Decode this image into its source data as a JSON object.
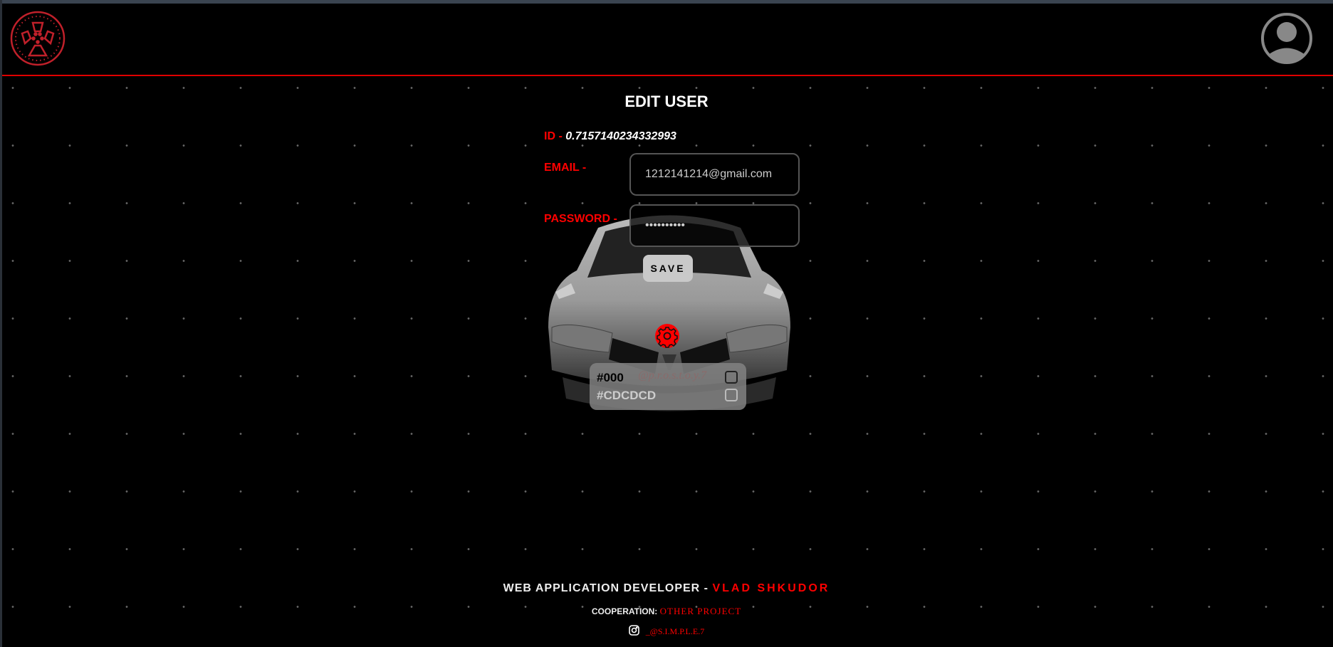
{
  "colors": {
    "accent": "#ff0000",
    "background": "#000000",
    "logo": "#c0202a",
    "avatar": "#888888"
  },
  "header": {
    "logo_icon": "wheel-rim-icon",
    "avatar_icon": "user-avatar-icon"
  },
  "form": {
    "title": "EDIT USER",
    "id_label": "ID -",
    "id_value": "0.7157140234332993",
    "email_label": "EMAIL -",
    "email_value": "1212141214@gmail.com",
    "password_label": "PASSWORD -",
    "password_value": "••••••••••",
    "save_label": "SAVE"
  },
  "theme_panel": {
    "settings_icon": "gear-icon",
    "options": [
      {
        "label": "#000",
        "checked": false
      },
      {
        "label": "#CDCDCD",
        "checked": false
      }
    ],
    "watermark": "@p.r.o.s.t.o.y.7"
  },
  "footer": {
    "developer_prefix": "WEB APPLICATION DEVELOPER -",
    "developer_name": "VLAD SHKUDOR",
    "cooperation_label": "COOPERATION:",
    "cooperation_link": "OTHER PROJECT",
    "instagram_icon": "instagram-icon",
    "instagram_handle": "_@S.I.M.P.L.E.7"
  }
}
